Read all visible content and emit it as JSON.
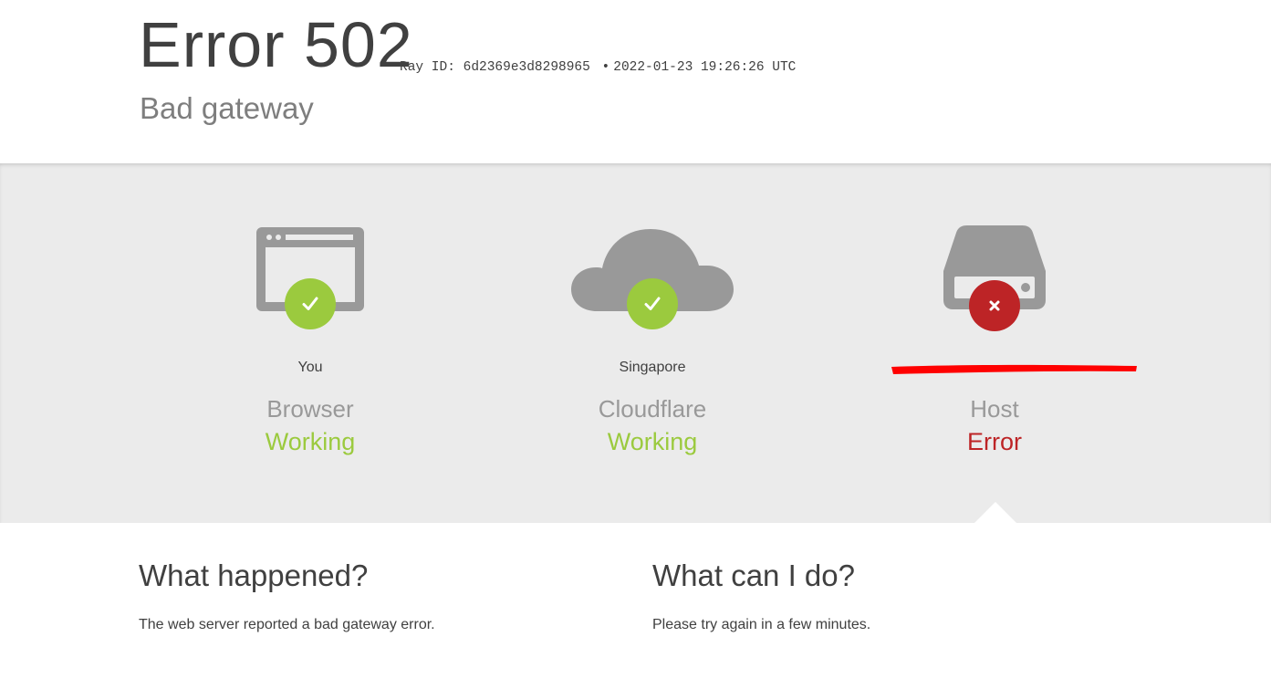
{
  "header": {
    "error_code": "Error 502",
    "ray_label": "Ray ID: 6d2369e3d8298965",
    "separator": "•",
    "timestamp": "2022-01-23 19:26:26 UTC",
    "subtitle": "Bad gateway"
  },
  "nodes": [
    {
      "location": "You",
      "role": "Browser",
      "state": "Working",
      "status": "ok",
      "icon": "browser-icon"
    },
    {
      "location": "Singapore",
      "role": "Cloudflare",
      "state": "Working",
      "status": "ok",
      "icon": "cloud-icon"
    },
    {
      "location": "",
      "role": "Host",
      "state": "Error",
      "status": "error",
      "icon": "server-icon"
    }
  ],
  "colors": {
    "ok": "#9bca3e",
    "error": "#bd2426",
    "icon_gray": "#999999",
    "band": "#ebebeb",
    "redaction": "#ff0000"
  },
  "what_happened": {
    "title": "What happened?",
    "body": "The web server reported a bad gateway error."
  },
  "what_can_i_do": {
    "title": "What can I do?",
    "body": "Please try again in a few minutes."
  }
}
